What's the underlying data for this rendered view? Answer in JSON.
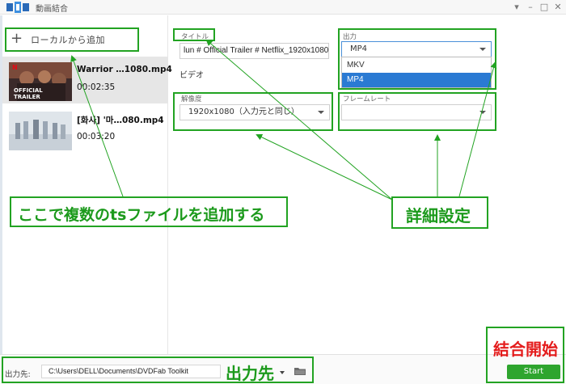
{
  "window": {
    "title": "動画結合",
    "controls": [
      "menu-icon",
      "minimize-icon",
      "maximize-icon",
      "close-icon"
    ]
  },
  "left_panel": {
    "add_button_label": "ローカルから追加",
    "files": [
      {
        "name": "Warrior …1080.mp4",
        "duration": "00:02:35",
        "thumbnail_text": "OFFICIAL TRAILER",
        "thumbnail_brand": "N",
        "selected": true
      },
      {
        "name": "[화사] '마…080.mp4",
        "duration": "00:03:20",
        "selected": false
      }
    ]
  },
  "settings": {
    "title_label": "タイトル",
    "title_value": "lun # Official Trailer # Netflix_1920x1080",
    "output_label": "出力",
    "output_value": "MP4",
    "output_options": [
      "MKV",
      "MP4"
    ],
    "output_selected_index": 1,
    "video_section": "ビデオ",
    "resolution_label": "解像度",
    "resolution_value": "1920x1080（入力元と同じ）",
    "framerate_label": "フレームレート",
    "framerate_value": ""
  },
  "bottom": {
    "output_dest_label": "出力先:",
    "output_path": "C:\\Users\\DELL\\Documents\\DVDFab Toolkit",
    "start_label": "Start"
  },
  "annotations": {
    "add_ts_files": "ここで複数のtsファイルを追加する",
    "detail_settings": "詳細設定",
    "output_dest": "出力先",
    "start_merge": "結合開始"
  },
  "colors": {
    "annotation": "#22a322",
    "annotation_text": "#1c9a1c",
    "merge_text": "#e41c1c",
    "start_button": "#2ea52e",
    "dropdown_selected": "#2a7ad3"
  }
}
